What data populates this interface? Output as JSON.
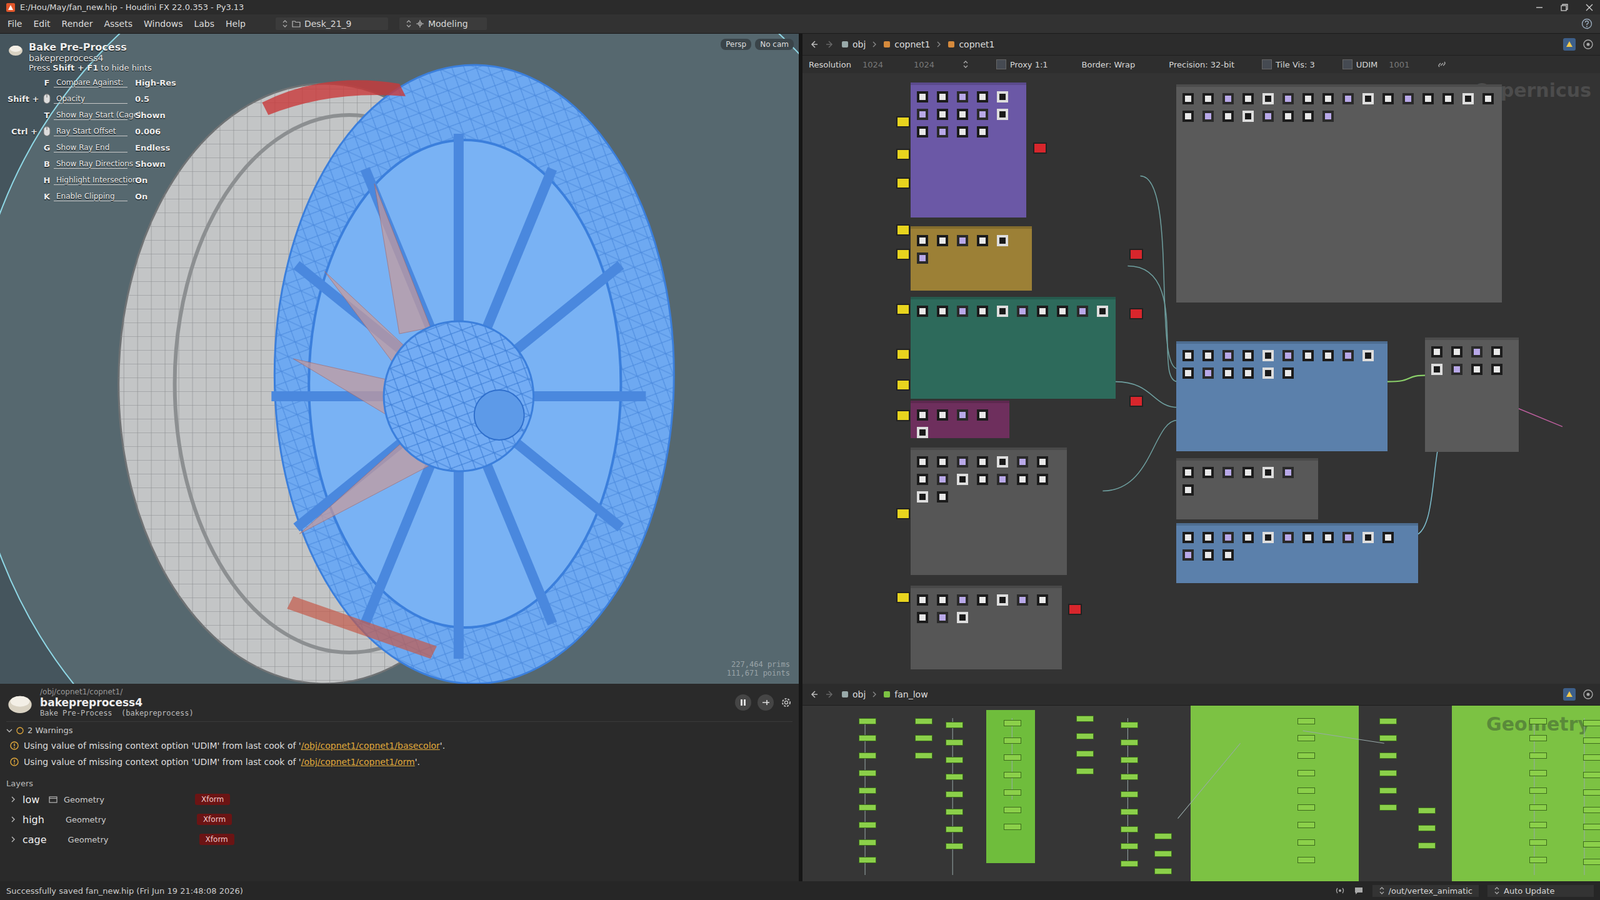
{
  "window": {
    "title": "E:/Hou/May/fan_new.hip - Houdini FX 22.0.353 - Py3.13"
  },
  "menu": [
    "File",
    "Edit",
    "Render",
    "Assets",
    "Windows",
    "Labs",
    "Help"
  ],
  "desktop": {
    "label": "Desk_21_9"
  },
  "context": {
    "label": "Modeling"
  },
  "viewport": {
    "tool_title": "Bake Pre-Process",
    "node": "bakepreprocess4",
    "hint_prefix": "Press ",
    "hint_key": "Shift + F1",
    "hint_suffix": " to hide hints",
    "hints": [
      {
        "kind": "key",
        "mod": "",
        "key": "F",
        "label": "Compare Against:",
        "value": "High-Res"
      },
      {
        "kind": "mouse",
        "mod": "Shift +",
        "key": "",
        "label": "Opacity",
        "value": "0.5"
      },
      {
        "kind": "key",
        "mod": "",
        "key": "T",
        "label": "Show Ray Start (Cage)",
        "value": "Shown"
      },
      {
        "kind": "mouse",
        "mod": "Ctrl +",
        "key": "",
        "label": "Ray Start Offset",
        "value": "0.006"
      },
      {
        "kind": "key",
        "mod": "",
        "key": "G",
        "label": "Show Ray End",
        "value": "Endless"
      },
      {
        "kind": "key",
        "mod": "",
        "key": "B",
        "label": "Show Ray Directions",
        "value": "Shown"
      },
      {
        "kind": "key",
        "mod": "",
        "key": "H",
        "label": "Highlight Intersections",
        "value": "On"
      },
      {
        "kind": "key",
        "mod": "",
        "key": "K",
        "label": "Enable Clipping",
        "value": "On"
      }
    ],
    "camera": [
      "Persp",
      "No cam"
    ],
    "stats": [
      "227,464 prims",
      "111,671 points"
    ]
  },
  "network": {
    "path": [
      "obj",
      "copnet1",
      "copnet1"
    ],
    "toolbar": {
      "resolution_label": "Resolution",
      "res_x": "1024",
      "res_y": "1024",
      "proxy": "Proxy 1:1",
      "border": "Border: Wrap",
      "precision": "Precision: 32-bit",
      "tile_vis": "Tile Vis: 3",
      "tile_vis_checked": false,
      "udim_label": "UDIM",
      "udim_checked": false,
      "udim": "1001"
    },
    "watermark": "Copernicus",
    "boxes": [
      {
        "color": "#6b58a6",
        "nodes": 14
      },
      {
        "color": "#9c8036",
        "nodes": 6
      },
      {
        "color": "#2d6a5b",
        "nodes": 10
      },
      {
        "color": "#6e2f5d",
        "nodes": 5
      },
      {
        "color": "#565656",
        "nodes": 16
      },
      {
        "color": "#565656",
        "nodes": 10
      },
      {
        "color": "#5a5a5a",
        "nodes": 24
      },
      {
        "color": "#5b80ab",
        "nodes": 16
      },
      {
        "color": "#585858",
        "nodes": 7
      },
      {
        "color": "#5b80ab",
        "nodes": 14
      },
      {
        "color": "#5a5a5a",
        "nodes": 8
      }
    ],
    "loose_nodes": [
      {
        "color": "#e8d41e"
      },
      {
        "color": "#e8d41e"
      },
      {
        "color": "#e8d41e"
      },
      {
        "color": "#e8d41e"
      },
      {
        "color": "#e8d41e"
      },
      {
        "color": "#e8d41e"
      },
      {
        "color": "#e8d41e"
      },
      {
        "color": "#e8d41e"
      },
      {
        "color": "#e8d41e"
      },
      {
        "color": "#e8d41e"
      },
      {
        "color": "#e8d41e"
      },
      {
        "color": "#d8262c"
      },
      {
        "color": "#d8262c"
      },
      {
        "color": "#d8262c"
      },
      {
        "color": "#d8262c"
      },
      {
        "color": "#d8262c"
      }
    ]
  },
  "info": {
    "path": "/obj/copnet1/copnet1/",
    "name": "bakepreprocess4",
    "type": "Bake Pre-Process  (bakepreprocess)",
    "warnings_title": "2 Warnings",
    "warnings_expanded": true,
    "warnings": [
      {
        "text": "Using value of missing context option 'UDIM' from last cook of '",
        "link": "/obj/copnet1/copnet1/basecolor",
        "end": "'."
      },
      {
        "text": "Using value of missing context option 'UDIM' from last cook of '",
        "link": "/obj/copnet1/copnet1/orm",
        "end": "'."
      }
    ],
    "layers_title": "Layers",
    "layers": [
      {
        "name": "low",
        "type": "Geometry",
        "tag": "Xform",
        "expanded": false,
        "framed": true
      },
      {
        "name": "high",
        "type": "Geometry",
        "tag": "Xform",
        "expanded": false,
        "framed": false
      },
      {
        "name": "cage",
        "type": "Geometry",
        "tag": "Xform",
        "expanded": false,
        "framed": false
      }
    ]
  },
  "geo": {
    "path": [
      "obj",
      "fan_low"
    ],
    "watermark": "Geometry",
    "node_count": 79,
    "boxes": [
      {
        "color": "#6fbd3c"
      },
      {
        "color": "#7cc243"
      },
      {
        "color": "#7cc243"
      }
    ]
  },
  "status_bar": {
    "message": "Successfully saved fan_new.hip (Fri Jun 19 21:48:08 2026)",
    "output": "/out/vertex_animatic",
    "update": "Auto Update"
  }
}
